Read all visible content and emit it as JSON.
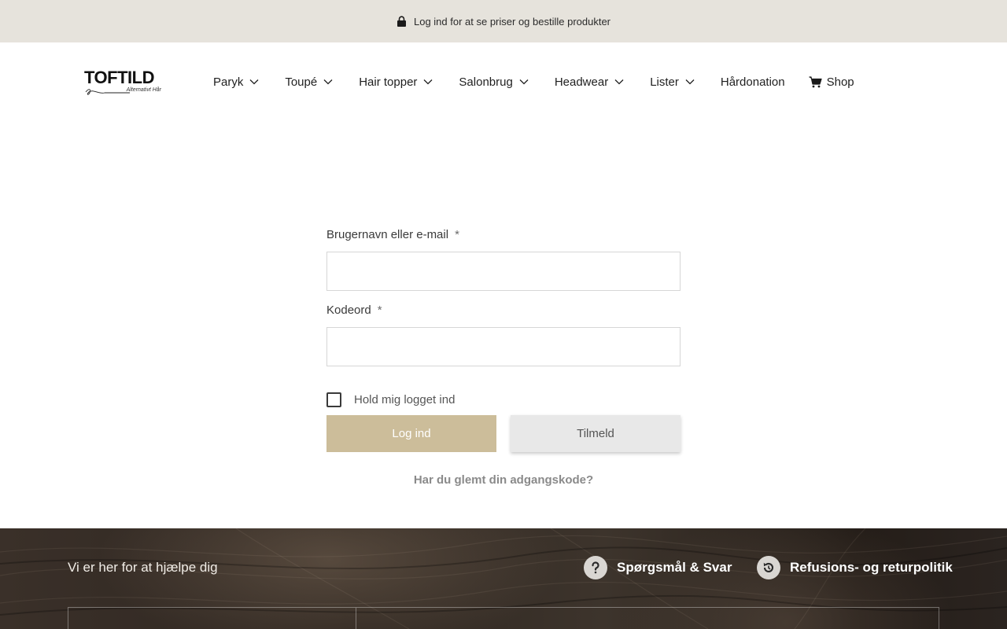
{
  "topbar": {
    "notice": "Log ind for at se priser og bestille produkter",
    "icon": "lock-icon"
  },
  "logo": {
    "name": "TOFTILD",
    "tagline": "Alternativt Hår"
  },
  "nav": {
    "items": [
      {
        "label": "Paryk",
        "icon": "chevron-down-icon"
      },
      {
        "label": "Toupé",
        "icon": "chevron-down-icon"
      },
      {
        "label": "Hair topper",
        "icon": "chevron-down-icon"
      },
      {
        "label": "Salonbrug",
        "icon": "chevron-down-icon"
      },
      {
        "label": "Headwear",
        "icon": "chevron-down-icon"
      },
      {
        "label": "Lister",
        "icon": "chevron-down-icon"
      },
      {
        "label": "Hårdonation"
      },
      {
        "label": "Shop",
        "icon": "cart-icon"
      }
    ]
  },
  "login": {
    "username_label": "Brugernavn eller e-mail",
    "username_value": "",
    "password_label": "Kodeord",
    "password_value": "",
    "required_marker": "*",
    "remember_label": "Hold mig logget ind",
    "remember_checked": false,
    "login_button": "Log ind",
    "register_button": "Tilmeld",
    "forgot_link": "Har du glemt din adgangskode?"
  },
  "footer": {
    "help_text": "Vi er her for at hjælpe dig",
    "faq_label": "Spørgsmål & Svar",
    "faq_icon": "question-icon",
    "refund_label": "Refusions- og returpolitik",
    "refund_icon": "refresh-icon"
  },
  "colors": {
    "topbar_bg": "#e6e3dc",
    "accent": "#ccbd9a",
    "secondary_button": "#e8e8e8",
    "footer_bg": "#2e2620"
  }
}
